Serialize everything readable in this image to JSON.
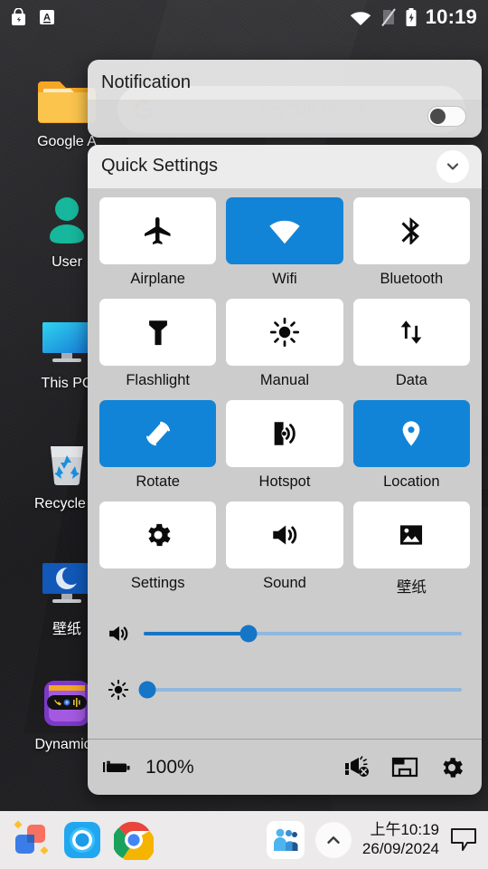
{
  "status_bar": {
    "left_icons": [
      {
        "name": "screenshot-lock-icon",
        "label": "screenshot"
      },
      {
        "name": "ime-keyboard-icon",
        "label": "A"
      }
    ],
    "right_icons": [
      {
        "name": "wifi-icon",
        "label": "wifi"
      },
      {
        "name": "no-sim-icon",
        "label": "no-sim"
      },
      {
        "name": "battery-charging-icon",
        "label": "charging"
      }
    ],
    "time": "10:19"
  },
  "desktop": {
    "icons": [
      {
        "name": "folder-icon",
        "label": "Google A",
        "type": "folder"
      },
      {
        "name": "user-icon",
        "label": "User",
        "type": "user"
      },
      {
        "name": "this-pc-icon",
        "label": "This PC",
        "type": "monitor"
      },
      {
        "name": "recycle-bin-icon",
        "label": "Recycle B",
        "type": "recycle"
      },
      {
        "name": "wallpaper-app-icon",
        "label": "壁纸",
        "type": "moon-monitor"
      },
      {
        "name": "dynamic-island-icon",
        "label": "Dynamic I",
        "type": "dynamic"
      }
    ]
  },
  "notification_panel": {
    "title": "Notification",
    "toggle_on": false
  },
  "quick_settings": {
    "title": "Quick Settings",
    "collapse_icon": "chevron-down-icon",
    "accent_on": "#1184d8",
    "tile_off_bg": "#ffffff",
    "panel_bg": "#cccccc",
    "header_bg": "#ececec",
    "tiles": [
      {
        "label": "Airplane",
        "icon": "airplane-icon",
        "active": false
      },
      {
        "label": "Wifi",
        "icon": "wifi-icon",
        "active": true
      },
      {
        "label": "Bluetooth",
        "icon": "bluetooth-icon",
        "active": false
      },
      {
        "label": "Flashlight",
        "icon": "flashlight-icon",
        "active": false
      },
      {
        "label": "Manual",
        "icon": "brightness-icon",
        "active": false
      },
      {
        "label": "Data",
        "icon": "data-arrows-icon",
        "active": false
      },
      {
        "label": "Rotate",
        "icon": "rotate-icon",
        "active": true
      },
      {
        "label": "Hotspot",
        "icon": "hotspot-icon",
        "active": false
      },
      {
        "label": "Location",
        "icon": "location-pin-icon",
        "active": true
      },
      {
        "label": "Settings",
        "icon": "gear-icon",
        "active": false
      },
      {
        "label": "Sound",
        "icon": "speaker-icon",
        "active": false
      },
      {
        "label": "壁纸",
        "icon": "image-icon",
        "active": false
      }
    ],
    "volume_slider": {
      "icon": "volume-icon",
      "percent": 33
    },
    "brightness_slider": {
      "icon": "brightness-icon",
      "percent": 1
    },
    "footer": {
      "battery_icon": "battery-charging-icon",
      "battery_text": "100%",
      "icons": [
        {
          "name": "do-not-disturb-icon"
        },
        {
          "name": "cast-screen-icon"
        },
        {
          "name": "gear-icon"
        }
      ]
    }
  },
  "taskbar": {
    "apps": [
      {
        "name": "taskbar-app-files-icon"
      },
      {
        "name": "taskbar-app-camera-icon"
      },
      {
        "name": "taskbar-app-chrome-icon"
      }
    ],
    "tray": {
      "teams_icon": "teams-icon",
      "expand_icon": "chevron-up-icon",
      "time": "上午10:19",
      "date": "26/09/2024",
      "notification_icon": "speech-bubble-icon"
    }
  }
}
